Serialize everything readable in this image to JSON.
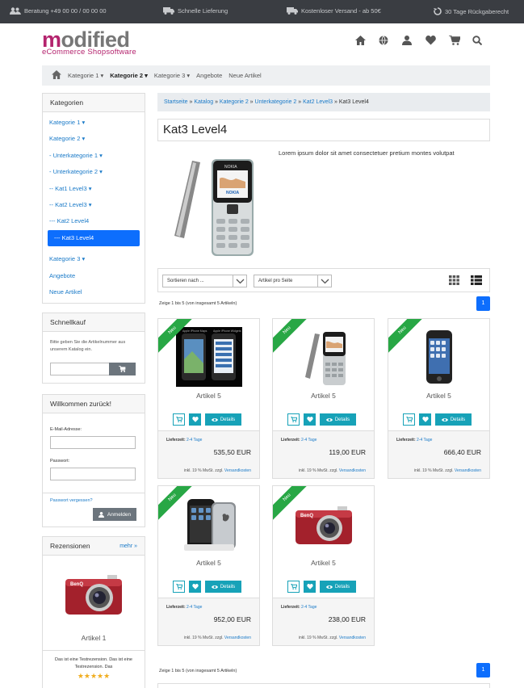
{
  "topbar": {
    "items": [
      {
        "icon": "users-icon",
        "label": "Beratung +49 00 00 / 00 00 00"
      },
      {
        "icon": "truck-icon",
        "label": "Schnelle Lieferung"
      },
      {
        "icon": "truck-icon",
        "label": "Kostenloser Versand - ab 50€"
      },
      {
        "icon": "return-icon",
        "label": "30 Tage Rückgaberecht"
      }
    ]
  },
  "logo": {
    "part1": "m",
    "part2": "odified",
    "tagline": "eCommerce Shopsoftware"
  },
  "header_icons": [
    "home-icon",
    "globe-icon",
    "user-icon",
    "heart-icon",
    "cart-icon",
    "search-icon"
  ],
  "nav": {
    "items": [
      {
        "label": "Kategorie 1 ▾"
      },
      {
        "label": "Kategorie 2 ▾"
      },
      {
        "label": "Kategorie 3 ▾"
      },
      {
        "label": "Angebote"
      },
      {
        "label": "Neue Artikel"
      }
    ]
  },
  "sidebar": {
    "categories_title": "Kategorien",
    "categories": [
      {
        "label": "Kategorie 1 ▾"
      },
      {
        "label": "Kategorie 2 ▾"
      },
      {
        "label": "- Unterkategorie 1 ▾"
      },
      {
        "label": "- Unterkategorie 2 ▾"
      },
      {
        "label": "-- Kat1 Level3 ▾"
      },
      {
        "label": "-- Kat2 Level3 ▾"
      },
      {
        "label": "--- Kat2 Level4"
      },
      {
        "label": "--- Kat3 Level4"
      },
      {
        "label": "Kategorie 3 ▾"
      },
      {
        "label": "Angebote"
      },
      {
        "label": "Neue Artikel"
      }
    ],
    "quick_title": "Schnellkauf",
    "quick_text": "Bitte geben Sie die Artikelnummer aus unserem Katalog ein.",
    "login_title": "Willkommen zurück!",
    "email_label": "E-Mail-Adresse:",
    "password_label": "Passwort:",
    "forgot": "Passwort vergessen?",
    "login_button": "Anmelden",
    "reviews_title": "Rezensionen",
    "reviews_more": "mehr »",
    "review_product": "Artikel 1",
    "review_text": "Das ist eine Testrezension. Das ist eine Testrezension. Das",
    "review_stars": "★★★★★"
  },
  "breadcrumb": {
    "links": [
      "Startseite",
      "Katalog",
      "Kategorie 2",
      "Unterkategorie 2",
      "Kat2 Level3"
    ],
    "sep": " » ",
    "current": "Kat3 Level4"
  },
  "page": {
    "title": "Kat3 Level4",
    "description": "Lorem ipsum dolor sit amet consectetuer pretium montes volutpat"
  },
  "sort": {
    "sort_select": "Sortieren nach ...",
    "per_page_select": "Artikel pro Seite"
  },
  "paging": {
    "text": "Zeige 1 bis 5 (von insgesamt 5 Artikeln)",
    "page": "1"
  },
  "product_common": {
    "new_badge": "Neu",
    "details": "Details",
    "delivery_label": "Lieferzeit:",
    "delivery_value": "2-4 Tage",
    "tax_text": "inkl. 19 % MwSt. zzgl.",
    "shipping_link": "Versandkosten"
  },
  "products": [
    {
      "name": "Artikel 5",
      "price": "535,50 EUR",
      "image": "iphone-screens-image"
    },
    {
      "name": "Artikel 5",
      "price": "119,00 EUR",
      "image": "nokia-phone-image"
    },
    {
      "name": "Artikel 5",
      "price": "666,40 EUR",
      "image": "iphone-image"
    },
    {
      "name": "Artikel 5",
      "price": "952,00 EUR",
      "image": "iphone-dock-image"
    },
    {
      "name": "Artikel 5",
      "price": "238,00 EUR",
      "image": "red-camera-image"
    }
  ],
  "colors": {
    "accent": "#0d6efd",
    "teal": "#17a2b8",
    "brand": "#b4246e",
    "new_badge": "#28a745",
    "topbar": "#3a3d42"
  }
}
